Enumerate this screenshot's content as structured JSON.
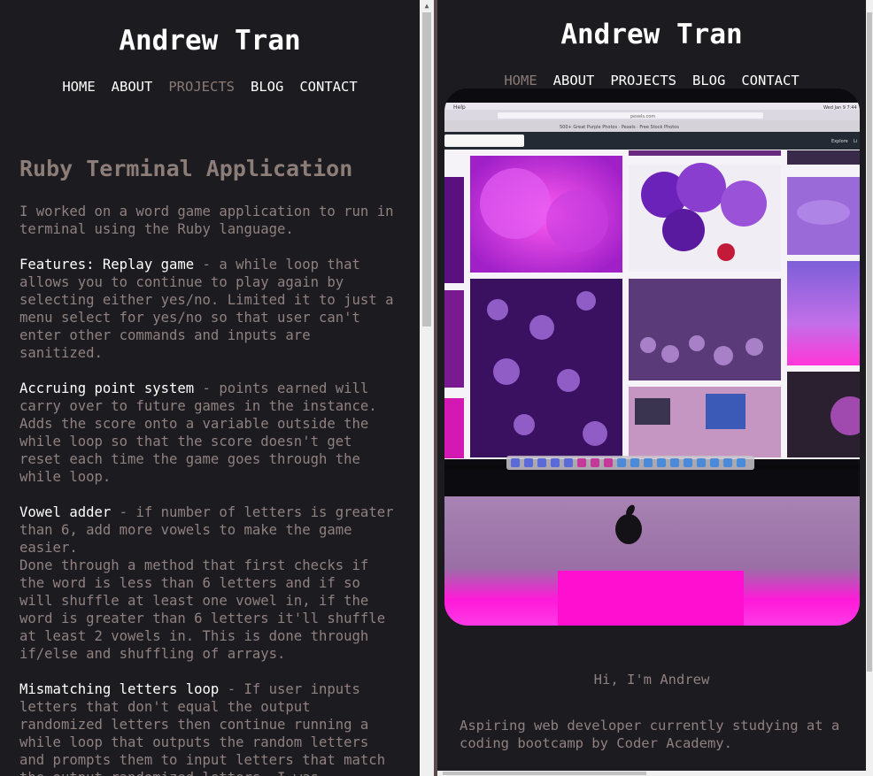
{
  "site": {
    "title": "Andrew Tran",
    "nav": [
      "HOME",
      "ABOUT",
      "PROJECTS",
      "BLOG",
      "CONTACT"
    ]
  },
  "left_pane": {
    "active_nav": "PROJECTS",
    "project_title": "Ruby Terminal Application",
    "intro": "I worked on a word game application to run in terminal using the Ruby language.",
    "features": [
      {
        "name": "Features: Replay game",
        "desc": " - a while loop that allows you to continue to play again by selecting either yes/no. Limited it to just a menu select for yes/no so that user can't enter other commands and inputs are sanitized."
      },
      {
        "name": "Accruing point system",
        "desc": " - points earned will carry over to future games in the instance. Adds the score onto a variable outside the while loop so that the score doesn't get reset each time the game goes through the while loop."
      },
      {
        "name": "Vowel adder",
        "desc": " - if number of letters is greater than 6, add more vowels to make the game easier.",
        "extra": "Done through a method that first checks if the word is less than 6 letters and if so will shuffle at least one vowel in, if the word is greater than 6 letters it'll shuffle at least 2 vowels in. This is done through if/else and shuffling of arrays."
      },
      {
        "name": "Mismatching letters loop",
        "desc": " - If user inputs letters that don't equal the output randomized letters then continue running a while loop that outputs the random letters and prompts them to input letters that match the output randomized letters. I was"
      }
    ]
  },
  "right_pane": {
    "active_nav": "HOME",
    "hero_image": {
      "menu_left": "Help",
      "menu_right": "Wed Jan 9  7:44",
      "address_bar": "pexels.com",
      "tab_title": "500+ Great Purple Photos · Pexels · Free Stock Photos",
      "site_nav": [
        "Explore",
        "Li"
      ]
    },
    "greeting": "Hi, I'm Andrew",
    "about": "Aspiring web developer currently studying at a coding bootcamp by Coder Academy."
  },
  "colors": {
    "background": "#1c1b1f",
    "heading": "#ffffff",
    "muted_text": "#8f8180",
    "project_title": "#8d7d78",
    "active_nav": "#8a7a76",
    "accent_magenta": "#ff1ad9"
  }
}
